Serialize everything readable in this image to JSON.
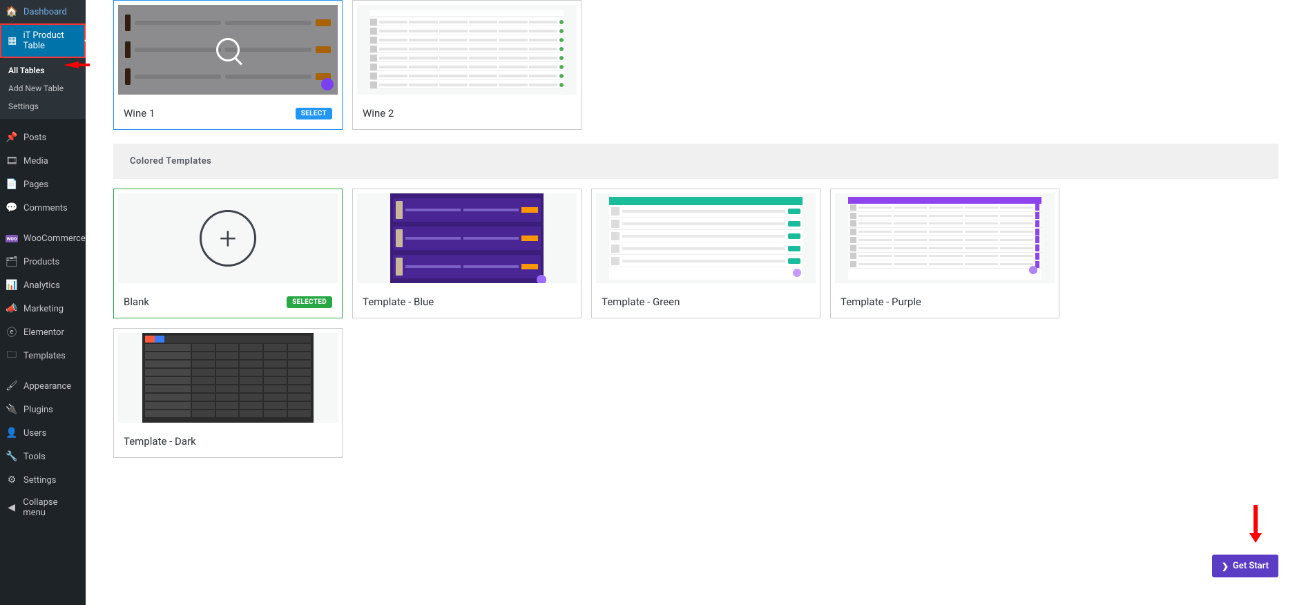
{
  "sidebar": {
    "items": [
      {
        "icon": "🏠",
        "label": "Dashboard"
      },
      {
        "icon": "▦",
        "label": "iT Product Table",
        "active": true
      },
      {
        "icon": "📌",
        "label": "Posts"
      },
      {
        "icon": "🎞",
        "label": "Media"
      },
      {
        "icon": "📄",
        "label": "Pages"
      },
      {
        "icon": "💬",
        "label": "Comments"
      },
      {
        "icon": "wc",
        "label": "WooCommerce"
      },
      {
        "icon": "🗂",
        "label": "Products"
      },
      {
        "icon": "📊",
        "label": "Analytics"
      },
      {
        "icon": "📣",
        "label": "Marketing"
      },
      {
        "icon": "ⓔ",
        "label": "Elementor"
      },
      {
        "icon": "🗀",
        "label": "Templates"
      },
      {
        "icon": "🖌",
        "label": "Appearance"
      },
      {
        "icon": "🔌",
        "label": "Plugins"
      },
      {
        "icon": "👤",
        "label": "Users"
      },
      {
        "icon": "🔧",
        "label": "Tools"
      },
      {
        "icon": "⚙",
        "label": "Settings"
      },
      {
        "icon": "◀",
        "label": "Collapse menu"
      }
    ],
    "submenu": [
      {
        "label": "All Tables",
        "current": true
      },
      {
        "label": "Add New Table"
      },
      {
        "label": "Settings"
      }
    ]
  },
  "top_templates": [
    {
      "name": "Wine 1",
      "badge": "SELECT",
      "badgeClass": "select",
      "thumb": "wine1",
      "selected": "blue"
    },
    {
      "name": "Wine 2",
      "thumb": "wine2"
    }
  ],
  "section_title": "Colored Templates",
  "colored_templates": [
    {
      "name": "Blank",
      "badge": "SELECTED",
      "badgeClass": "selected",
      "thumb": "blank",
      "selected": "green"
    },
    {
      "name": "Template - Blue",
      "thumb": "blue"
    },
    {
      "name": "Template - Green",
      "thumb": "green"
    },
    {
      "name": "Template - Purple",
      "thumb": "purple"
    },
    {
      "name": "Template - Dark",
      "thumb": "dark"
    }
  ],
  "get_start_label": "Get Start"
}
